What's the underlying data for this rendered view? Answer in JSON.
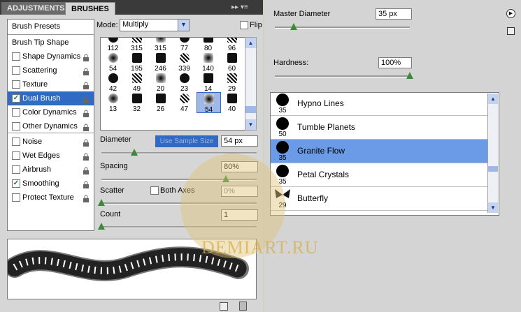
{
  "tabs": {
    "adjustments": "ADJUSTMENTS",
    "brushes": "BRUSHES",
    "menu": "▸▸ ▾≡"
  },
  "sidebar": {
    "preset_label": "Brush Presets",
    "tip_label": "Brush Tip Shape",
    "items": [
      {
        "label": "Shape Dynamics",
        "checked": false
      },
      {
        "label": "Scattering",
        "checked": false
      },
      {
        "label": "Texture",
        "checked": false
      },
      {
        "label": "Dual Brush",
        "checked": true,
        "selected": true
      },
      {
        "label": "Color Dynamics",
        "checked": false
      },
      {
        "label": "Other Dynamics",
        "checked": false
      },
      {
        "label": "Noise",
        "checked": false
      },
      {
        "label": "Wet Edges",
        "checked": false
      },
      {
        "label": "Airbrush",
        "checked": false
      },
      {
        "label": "Smoothing",
        "checked": true
      },
      {
        "label": "Protect Texture",
        "checked": false
      }
    ]
  },
  "mode": {
    "label": "Mode:",
    "value": "Multiply"
  },
  "flip": {
    "label": "Flip"
  },
  "brush_grid": [
    "112",
    "315",
    "315",
    "77",
    "80",
    "96",
    "54",
    "195",
    "246",
    "339",
    "140",
    "60",
    "42",
    "49",
    "20",
    "23",
    "14",
    "29",
    "13",
    "32",
    "26",
    "47",
    "54",
    "40"
  ],
  "selected_brush": "54",
  "diameter": {
    "label": "Diameter",
    "value": "54 px",
    "sample_button": "Use Sample Size",
    "level": 0.21
  },
  "spacing": {
    "label": "Spacing",
    "value": "80%",
    "level": 0.8
  },
  "scatter": {
    "label": "Scatter",
    "both_axes": "Both Axes",
    "value": "0%",
    "level": 0
  },
  "count": {
    "label": "Count",
    "value": "1",
    "level": 0
  },
  "right": {
    "master_diameter": {
      "label": "Master Diameter",
      "value": "35 px",
      "level": 0.14
    },
    "hardness": {
      "label": "Hardness:",
      "value": "100%",
      "level": 1
    },
    "presets": [
      {
        "name": "Hypno Lines",
        "size": "35"
      },
      {
        "name": "Tumble Planets",
        "size": "50"
      },
      {
        "name": "Granite Flow",
        "size": "35",
        "selected": true
      },
      {
        "name": "Petal Crystals",
        "size": "35"
      },
      {
        "name": "Butterfly",
        "size": "29"
      }
    ]
  },
  "watermark": "DEMIART.RU",
  "colors": {
    "selection": "#316ac5",
    "highlight_row": "#6b9be6",
    "check": "#1a7a1a"
  }
}
